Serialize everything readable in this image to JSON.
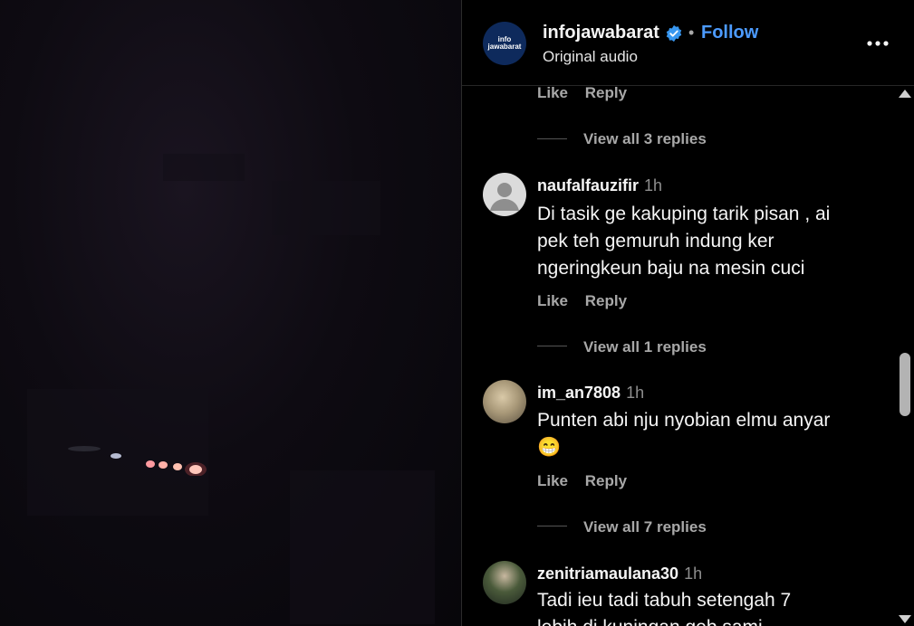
{
  "header": {
    "username": "infojawabarat",
    "dot": "•",
    "follow_label": "Follow",
    "subtitle": "Original audio",
    "brand_text_top": "info",
    "brand_text_bottom": "jawabarat"
  },
  "comments": {
    "partial": {
      "like_label": "Like",
      "reply_label": "Reply",
      "view_replies": "View all 3 replies"
    },
    "items": [
      {
        "username": "naufalfauzifir",
        "time": "1h",
        "lines": [
          "Di tasik ge kakuping tarik pisan , ai",
          "pek teh gemuruh indung ker",
          "ngeringkeun baju na mesin cuci"
        ],
        "like_label": "Like",
        "reply_label": "Reply",
        "view_replies": "View all 1 replies"
      },
      {
        "username": "im_an7808",
        "time": "1h",
        "lines": [
          "Punten abi nju nyobian elmu anyar",
          "😁"
        ],
        "like_label": "Like",
        "reply_label": "Reply",
        "view_replies": "View all 7 replies"
      },
      {
        "username": "zenitriamaulana30",
        "time": "1h",
        "lines": [
          "Tadi ieu tadi tabuh setengah 7",
          "lebih di kuningan geb sami"
        ]
      }
    ]
  },
  "colors": {
    "follow": "#4c9bff",
    "verified": "#3897f0",
    "brand_bg": "#0e2a5c"
  },
  "icons": [
    "verified-badge-icon",
    "more-options-icon",
    "default-avatar-icon",
    "scroll-up-arrow-icon",
    "scroll-down-arrow-icon"
  ]
}
